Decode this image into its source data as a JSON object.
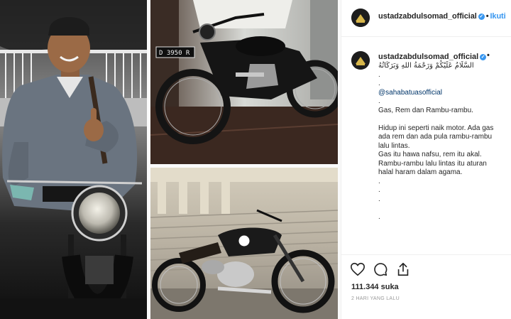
{
  "post": {
    "username": "ustadzabdulsomad_official",
    "separator": "•",
    "follow_label": "Ikuti",
    "more_label": "•",
    "caption_lines": [
      {
        "text": "السَّلَامُ عَلَيْكُمْ وَرَحْمَةُ اللهِ وَبَرَكَاتُهُ",
        "kind": "arab"
      },
      {
        "text": ".",
        "kind": "text"
      },
      {
        "text": ".",
        "kind": "text"
      },
      {
        "text": "@sahabatuasofficial",
        "kind": "mention"
      },
      {
        "text": ".",
        "kind": "text"
      },
      {
        "text": "Gas, Rem dan Rambu-rambu.",
        "kind": "text"
      },
      {
        "text": "",
        "kind": "gap"
      },
      {
        "text": "Hidup ini seperti naik motor. Ada gas",
        "kind": "text"
      },
      {
        "text": "ada rem dan ada pula rambu-rambu",
        "kind": "text"
      },
      {
        "text": "lalu lintas.",
        "kind": "text"
      },
      {
        "text": "Gas itu hawa nafsu, rem itu akal.",
        "kind": "text"
      },
      {
        "text": "Rambu-rambu lalu lintas itu aturan",
        "kind": "text"
      },
      {
        "text": "halal haram dalam agama.",
        "kind": "text"
      },
      {
        "text": ".",
        "kind": "text"
      },
      {
        "text": ".",
        "kind": "text"
      },
      {
        "text": ".",
        "kind": "text"
      },
      {
        "text": "",
        "kind": "gap"
      },
      {
        "text": ".",
        "kind": "text"
      }
    ],
    "likes": "111.344 suka",
    "timestamp": "2 HARI YANG LALU",
    "license_plate": "D 3950 R"
  },
  "colors": {
    "link": "#3897f0",
    "mention": "#003569",
    "border": "#efefef",
    "muted": "#999999"
  },
  "icons": [
    "heart-icon",
    "comment-icon",
    "share-icon",
    "verified-icon"
  ]
}
